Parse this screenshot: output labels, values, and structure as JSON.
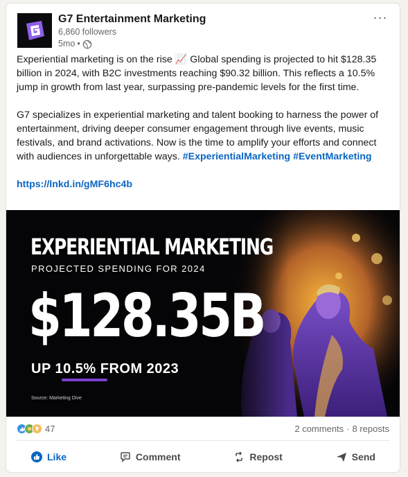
{
  "post": {
    "author": {
      "name": "G7 Entertainment Marketing",
      "followers": "6,860 followers",
      "time": "5mo",
      "separator": "•"
    },
    "body": {
      "p1": "Experiential marketing is on the rise 📈 Global spending is projected to hit $128.35 billion in 2024, with B2C investments reaching $90.32 billion. This reflects a 10.5% jump in growth from last year, surpassing pre-pandemic levels for the first time.",
      "p2_main": "G7 specializes in experiential marketing and talent booking to harness the power of entertainment, driving deeper consumer engagement through live events, music festivals, and brand activations. Now is the time to amplify your efforts and connect with audiences in unforgettable ways. ",
      "hashtag1": "#ExperientialMarketing",
      "hashtag2": "#EventMarketing",
      "link": "https://lnkd.in/gMF6hc4b"
    },
    "banner": {
      "title": "EXPERIENTIAL MARKETING",
      "subtitle": "PROJECTED SPENDING FOR 2024",
      "amount": "$128.35B",
      "growth": "UP 10.5% FROM 2023",
      "source": "Source: Marketing Dive"
    },
    "stats": {
      "reaction_count": "47",
      "comments": "2 comments",
      "dot": "·",
      "reposts": "8 reposts"
    },
    "actions": {
      "like": "Like",
      "comment": "Comment",
      "repost": "Repost",
      "send": "Send"
    },
    "colors": {
      "link": "#0a66c2",
      "banner_bg": "#050507",
      "accent_purple": "#7b3fd1"
    }
  }
}
